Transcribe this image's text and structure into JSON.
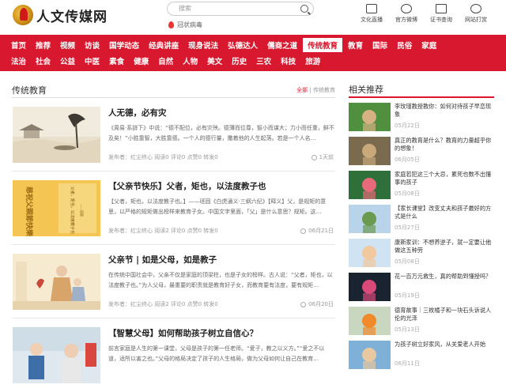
{
  "header": {
    "logo_text": "人文传媒网",
    "search_placeholder": "搜索",
    "hot_topic": "冠状病毒",
    "tools": [
      {
        "label": "文化直播",
        "icon": "live-tv-icon"
      },
      {
        "label": "官方微博",
        "icon": "weibo-icon"
      },
      {
        "label": "证书查询",
        "icon": "certificate-icon"
      },
      {
        "label": "网站打赏",
        "icon": "reward-icon"
      }
    ]
  },
  "nav": {
    "row1": [
      "首页",
      "推荐",
      "视频",
      "访谈",
      "国学动态",
      "经典讲座",
      "现身说法",
      "弘德达人",
      "儒商之道",
      "传统教育",
      "教育",
      "国际",
      "民俗",
      "家庭"
    ],
    "row2": [
      "法治",
      "社会",
      "公益",
      "中医",
      "素食",
      "健康",
      "自然",
      "人物",
      "美文",
      "历史",
      "三农",
      "科技",
      "旅游"
    ],
    "active": "传统教育"
  },
  "section": {
    "title": "传统教育",
    "link_all": "全部",
    "link_sep": "|",
    "link_cat": "传统教育"
  },
  "articles": [
    {
      "title": "人无德，必有灾",
      "desc": "《周易·系辞下》中说：“德不配位，必有灾殃。德薄而位尊，智小而谋大；力小而任重，鲜不及矣！”小胜靠智，大胜靠德。一个人的德行量，撒着他的人生起落。若是一个人名…",
      "meta": "发布者：红尘终心    阅读0    评论0    点赞0    转发0",
      "time": "1天前"
    },
    {
      "title": "【父亲节快乐】父者，矩也，以法度教子也",
      "desc": "【父者，矩也，以法度教子也。】——班固《白虎通义·三纲六纪》【释义】父，是规矩的意思，以严格的规矩做出榜样来教育子女。中国文字里面，「父」是什么意思？规矩。这…",
      "meta": "发布者：红尘终心    阅读2    评论0    点赞0    转发0",
      "time": "06月21日"
    },
    {
      "title": "父亲节 | 如是父母，如是教子",
      "desc": "在传统中国社会中，父亲不仅是家庭的顶梁柱，也是子女的榜样。古人说：“父者，矩也，以法度教子也。”为人父母，最重要的职责就是教育好子女，而教育要有法度，要有规矩…",
      "meta": "发布者：红尘终心    阅读2    评论0    点赞0    转发0",
      "time": "06月20日"
    },
    {
      "title": "【智慧父母】如何帮助孩子树立自信心？",
      "desc": "前言家庭是人生的第一课堂，父母是孩子的第一任老师。“爱子，教之以义方。”“爱之不以道，适所以害之也。”父母的格局决定了孩子的人生格局，做为父母如何让自己在教育…",
      "meta": "",
      "time": ""
    }
  ],
  "thumb_text": {
    "a2_big": "慈祝父親節快樂",
    "a2_small": "父者，矩也，以法度教子也",
    "a2_credit": "——班固"
  },
  "sidebar": {
    "title": "相关推荐",
    "items": [
      {
        "text": "李玫瑾教授教你：如何对待孩子早恋现象",
        "date": "05月22日"
      },
      {
        "text": "真正的教育是什么？教育的力量超乎你的想象！",
        "date": "06月05日"
      },
      {
        "text": "家庭若犯这三个大忌，累死也数不出懂事的孩子",
        "date": "05月08日"
      },
      {
        "text": "【家长课堂】改变丈夫和孩子最好的方式是什么",
        "date": "05月27日"
      },
      {
        "text": "康斯家训：不想养逆子，就一定要让他做这五种劳",
        "date": "05月08日"
      },
      {
        "text": "花一百万元救生，真的帮助到懂授吗？",
        "date": "05月19日"
      },
      {
        "text": "德育故事｜三枚橘子和一块石头诉说人伦的光泽",
        "date": "05月13日"
      },
      {
        "text": "为孩子树立好家风，从关爱老人开始",
        "date": "06月11日"
      }
    ]
  },
  "colors": {
    "brand": "#d8182e"
  }
}
